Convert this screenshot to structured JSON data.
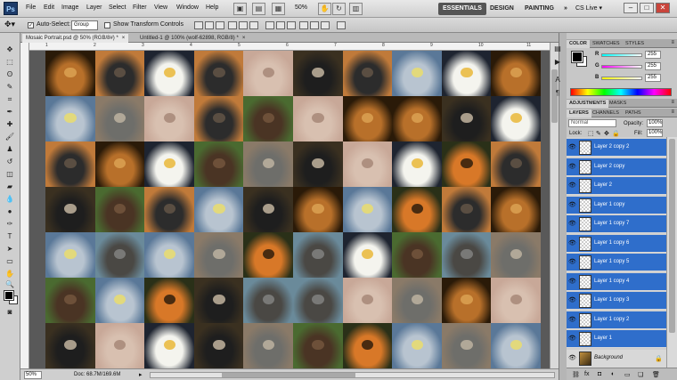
{
  "app": {
    "logo": "Ps",
    "menu": [
      "File",
      "Edit",
      "Image",
      "Layer",
      "Select",
      "Filter",
      "View",
      "Window",
      "Help"
    ],
    "zoom": "50%",
    "workspaces": [
      "ESSENTIALS",
      "DESIGN",
      "PAINTING"
    ],
    "more": "»",
    "cs_live": "CS Live ▾"
  },
  "options": {
    "auto_select_label": "Auto-Select:",
    "auto_select_checked": true,
    "group_value": "Group",
    "transform_label": "Show Transform Controls"
  },
  "tabs": [
    {
      "label": "Mosaic Portrait.psd @ 50% (RGB/8#) *",
      "active": true
    },
    {
      "label": "Untitled-1 @ 100% (wolf-62898, RGB/8) *",
      "active": false
    }
  ],
  "ruler_marks": [
    "1",
    "2",
    "3",
    "4",
    "5",
    "6",
    "7",
    "8",
    "9",
    "10",
    "11"
  ],
  "status": {
    "zoom": "50%",
    "doc": "Doc: 68.7M/169.6M"
  },
  "color_panel": {
    "tabs": [
      "COLOR",
      "SWATCHES",
      "STYLES"
    ],
    "channels": [
      {
        "label": "R",
        "value": "255",
        "gradient": "linear-gradient(90deg,#00ffff,#ffffff)"
      },
      {
        "label": "G",
        "value": "255",
        "gradient": "linear-gradient(90deg,#ff00ff,#ffffff)"
      },
      {
        "label": "B",
        "value": "255",
        "gradient": "linear-gradient(90deg,#ffff00,#ffffff)"
      }
    ]
  },
  "adjustments": {
    "tabs": [
      "ADJUSTMENTS",
      "MASKS"
    ]
  },
  "layers_panel": {
    "tabs": [
      "LAYERS",
      "CHANNELS",
      "PATHS"
    ],
    "blend_mode": "Normal",
    "opacity_label": "Opacity:",
    "opacity": "100%",
    "lock_label": "Lock:",
    "fill_label": "Fill:",
    "fill": "100%",
    "layers": [
      {
        "name": "Layer 2 copy 2",
        "selected": true
      },
      {
        "name": "Layer 2 copy",
        "selected": true
      },
      {
        "name": "Layer 2",
        "selected": true
      },
      {
        "name": "Layer 1 copy",
        "selected": true
      },
      {
        "name": "Layer 1 copy 7",
        "selected": true
      },
      {
        "name": "Layer 1 copy 6",
        "selected": true
      },
      {
        "name": "Layer 1 copy 5",
        "selected": true
      },
      {
        "name": "Layer 1 copy 4",
        "selected": true
      },
      {
        "name": "Layer 1 copy 3",
        "selected": true
      },
      {
        "name": "Layer 1 copy 2",
        "selected": true
      },
      {
        "name": "Layer 1",
        "selected": true
      },
      {
        "name": "Background",
        "selected": false,
        "locked": true
      }
    ]
  },
  "mosaic": {
    "animals": {
      "lion": {
        "bg": "#2a1a08",
        "main": "#b8702a",
        "accent": "#e0a858"
      },
      "horse": {
        "bg": "#c07a3a",
        "main": "#2c2c2c",
        "accent": "#6a5a4a"
      },
      "eagle": {
        "bg": "#1e2430",
        "main": "#f4f4ee",
        "accent": "#e8b020"
      },
      "wolf": {
        "bg": "#8a7a68",
        "main": "#6e6e6a",
        "accent": "#c8bca8"
      },
      "mist": {
        "bg": "#c8a898",
        "main": "#d8c0b0",
        "accent": "#a08070"
      },
      "husky": {
        "bg": "#3a3020",
        "main": "#1e1e1e",
        "accent": "#d8c8b0"
      },
      "owl": {
        "bg": "#5a7898",
        "main": "#b8c4d0",
        "accent": "#f0e060"
      },
      "bear": {
        "bg": "#4a6a30",
        "main": "#4a3424",
        "accent": "#7a5a40"
      },
      "tiger": {
        "bg": "#2a3018",
        "main": "#d87828",
        "accent": "#1a1208"
      },
      "elephant": {
        "bg": "#6a8a9a",
        "main": "#4a4844",
        "accent": "#8a8a88"
      }
    },
    "rows": [
      [
        "lion",
        "horse",
        "eagle",
        "horse",
        "mist",
        "husky",
        "horse",
        "owl",
        "eagle",
        "lion"
      ],
      [
        "owl",
        "wolf",
        "mist",
        "horse",
        "bear",
        "mist",
        "lion",
        "lion",
        "husky",
        "eagle"
      ],
      [
        "horse",
        "lion",
        "eagle",
        "bear",
        "wolf",
        "husky",
        "mist",
        "eagle",
        "tiger",
        "horse"
      ],
      [
        "husky",
        "bear",
        "horse",
        "owl",
        "husky",
        "lion",
        "owl",
        "tiger",
        "horse",
        "lion"
      ],
      [
        "owl",
        "elephant",
        "owl",
        "wolf",
        "tiger",
        "elephant",
        "eagle",
        "bear",
        "elephant",
        "wolf"
      ],
      [
        "bear",
        "owl",
        "tiger",
        "husky",
        "elephant",
        "elephant",
        "mist",
        "wolf",
        "lion",
        "mist"
      ],
      [
        "husky",
        "mist",
        "eagle",
        "husky",
        "wolf",
        "bear",
        "tiger",
        "owl",
        "wolf",
        "owl"
      ]
    ]
  }
}
